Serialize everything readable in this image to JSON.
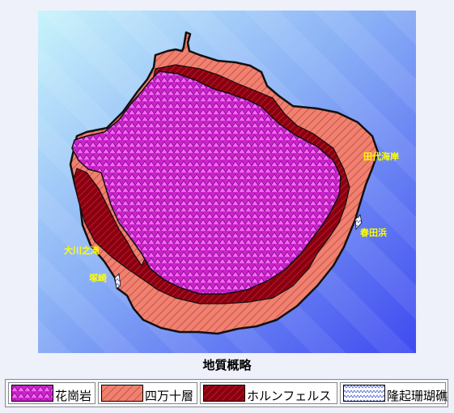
{
  "map": {
    "place_labels": {
      "tashiro": "田代海岸",
      "harutahama": "春田浜",
      "okawanotaki": "大川之滝",
      "tsukazaki": "塚崎"
    },
    "colors": {
      "sea_light": "#c8f4fb",
      "sea_dark": "#3f4af0",
      "granite": "#cc22cc",
      "shimanto": "#f08070",
      "hornfels": "#8b0010",
      "reef": "#ffffff",
      "label": "#ffff00"
    }
  },
  "caption": "地質概略",
  "legend": {
    "items": [
      {
        "label": "花崗岩",
        "pattern": "granite-pattern"
      },
      {
        "label": "四万十層",
        "pattern": "shimanto-hatch"
      },
      {
        "label": "ホルンフェルス",
        "pattern": "hornfels-hatch"
      },
      {
        "label": "隆起珊瑚礁",
        "pattern": "reef-zigzag"
      }
    ]
  }
}
